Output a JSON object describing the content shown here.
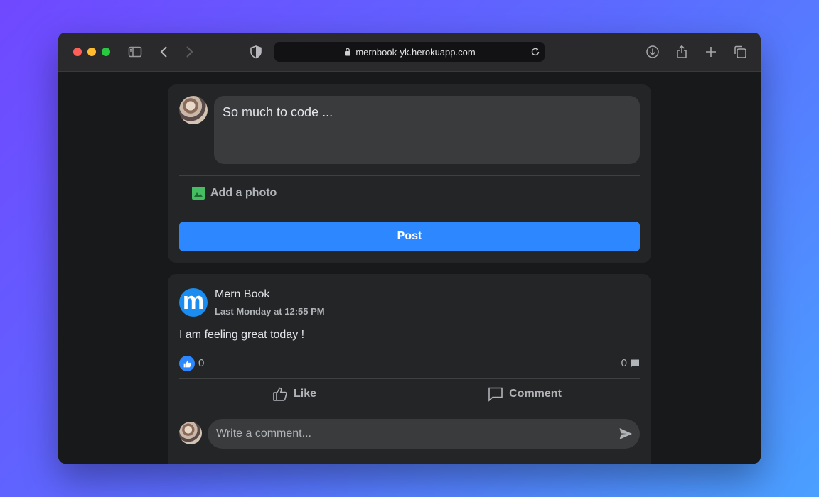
{
  "browser": {
    "url": "mernbook-yk.herokuapp.com",
    "traffic_colors": [
      "#ff5f57",
      "#febc2e",
      "#28c840"
    ]
  },
  "composer": {
    "text": "So much to code ...",
    "add_photo_label": "Add a photo",
    "post_button": "Post"
  },
  "post": {
    "author": "Mern Book",
    "time": "Last Monday at 12:55 PM",
    "text": "I am feeling great today !",
    "like_count": "0",
    "comment_count": "0",
    "like_label": "Like",
    "comment_label": "Comment",
    "comment_placeholder": "Write a comment...",
    "logo_letter": "m"
  },
  "colors": {
    "accent": "#2d88ff",
    "photo_icon": "#45bd62"
  },
  "icons": [
    "sidebar-icon",
    "back-icon",
    "forward-icon",
    "shield-icon",
    "lock-icon",
    "reload-icon",
    "download-icon",
    "share-icon",
    "new-tab-icon",
    "tabs-icon",
    "photo-icon",
    "like-icon",
    "comment-icon",
    "send-icon"
  ]
}
